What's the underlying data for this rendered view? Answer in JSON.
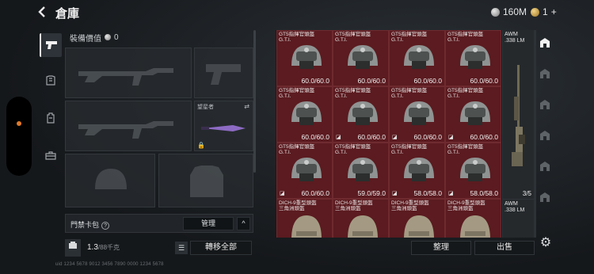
{
  "header": {
    "title": "倉庫",
    "silver_amount": "160M",
    "gold_amount": "1",
    "gold_plus": "+"
  },
  "categories": [
    {
      "icon": "pistol-icon",
      "active": true
    },
    {
      "icon": "armor-icon",
      "active": false
    },
    {
      "icon": "backpack-icon",
      "active": false
    },
    {
      "icon": "toolbox-icon",
      "active": false
    }
  ],
  "equipment": {
    "value_label": "裝備價值",
    "value_amount": "0",
    "watcher_label": "望星者"
  },
  "access_card": {
    "label": "門禁卡包",
    "help": "?",
    "manage_label": "管理",
    "expand_label": "^"
  },
  "weight": {
    "current": "1.3",
    "max": "/88千克"
  },
  "transfer_all_label": "轉移全部",
  "footer_id": "uid 1234 5678 9012 3456 7890 0000 1234 5678",
  "inventory": {
    "cells": [
      {
        "name1": "GT5指揮官頭盔",
        "name2": "G.T.I.",
        "dura": "60.0/60.0",
        "flag": ""
      },
      {
        "name1": "GT5指揮官頭盔",
        "name2": "G.T.I.",
        "dura": "60.0/60.0",
        "flag": ""
      },
      {
        "name1": "GT5指揮官頭盔",
        "name2": "G.T.I.",
        "dura": "60.0/60.0",
        "flag": ""
      },
      {
        "name1": "GT5指揮官頭盔",
        "name2": "G.T.I.",
        "dura": "60.0/60.0",
        "flag": ""
      },
      {
        "name1": "GT5指揮官頭盔",
        "name2": "G.T.I.",
        "dura": "60.0/60.0",
        "flag": ""
      },
      {
        "name1": "GT5指揮官頭盔",
        "name2": "G.T.I.",
        "dura": "60.0/60.0",
        "flag": "◪"
      },
      {
        "name1": "GT5指揮官頭盔",
        "name2": "G.T.I.",
        "dura": "60.0/60.0",
        "flag": "◪"
      },
      {
        "name1": "GT5指揮官頭盔",
        "name2": "G.T.I.",
        "dura": "60.0/60.0",
        "flag": "◪"
      },
      {
        "name1": "GT5指揮官頭盔",
        "name2": "G.T.I.",
        "dura": "60.0/60.0",
        "flag": "◪"
      },
      {
        "name1": "GT5指揮官頭盔",
        "name2": "G.T.I.",
        "dura": "59.0/59.0",
        "flag": ""
      },
      {
        "name1": "GT5指揮官頭盔",
        "name2": "G.T.I.",
        "dura": "58.0/58.0",
        "flag": "◪"
      },
      {
        "name1": "GT5指揮官頭盔",
        "name2": "G.T.I.",
        "dura": "58.0/58.0",
        "flag": "◪"
      },
      {
        "name1": "DICH-9重型頭盔",
        "name2": "三角洲頭盔",
        "dura": "",
        "flag": ""
      },
      {
        "name1": "DICH-9重型頭盔",
        "name2": "三角洲頭盔",
        "dura": "",
        "flag": ""
      },
      {
        "name1": "DICH-9重型頭盔",
        "name2": "三角洲頭盔",
        "dura": "",
        "flag": ""
      },
      {
        "name1": "DICH-9重型頭盔",
        "name2": "三角洲頭盔",
        "dura": "",
        "flag": ""
      }
    ],
    "sniper": {
      "name1": "AWM",
      "name2": ".338 LM",
      "count": "3/5"
    },
    "sniper2": {
      "name1": "AWM",
      "name2": ".338 LM"
    }
  },
  "buttons": {
    "arrange": "整理",
    "sell": "出售"
  },
  "colors": {
    "cell_red": "#5b1b20",
    "accent_orange": "#e07a2a"
  }
}
